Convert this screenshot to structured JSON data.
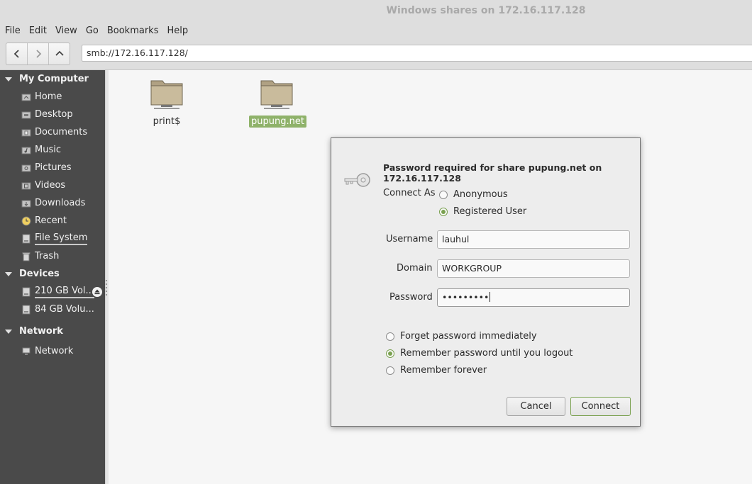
{
  "window": {
    "title": "Windows shares on 172.16.117.128"
  },
  "menubar": {
    "items": [
      "File",
      "Edit",
      "View",
      "Go",
      "Bookmarks",
      "Help"
    ]
  },
  "toolbar": {
    "location": "smb://172.16.117.128/"
  },
  "sidebar": {
    "sections": [
      {
        "title": "My Computer",
        "items": [
          "Home",
          "Desktop",
          "Documents",
          "Music",
          "Pictures",
          "Videos",
          "Downloads",
          "Recent",
          "File System",
          "Trash"
        ]
      },
      {
        "title": "Devices",
        "items": [
          "210 GB Vol...",
          "84 GB Volu..."
        ]
      },
      {
        "title": "Network",
        "items": [
          "Network"
        ]
      }
    ]
  },
  "files": [
    {
      "name": "print$"
    },
    {
      "name": "pupung.net"
    }
  ],
  "dialog": {
    "heading": "Password required for share pupung.net on 172.16.117.128",
    "connect_as_label": "Connect As",
    "connect_as_options": [
      "Anonymous",
      "Registered User"
    ],
    "username_label": "Username",
    "username_value": "lauhul",
    "domain_label": "Domain",
    "domain_value": "WORKGROUP",
    "password_label": "Password",
    "password_value": "•••••••••",
    "remember_options": [
      "Forget password immediately",
      "Remember password until you logout",
      "Remember forever"
    ],
    "cancel_label": "Cancel",
    "connect_label": "Connect"
  },
  "colors": {
    "accent": "#8fb26a",
    "sidebar_bg": "#4a4a4a"
  }
}
